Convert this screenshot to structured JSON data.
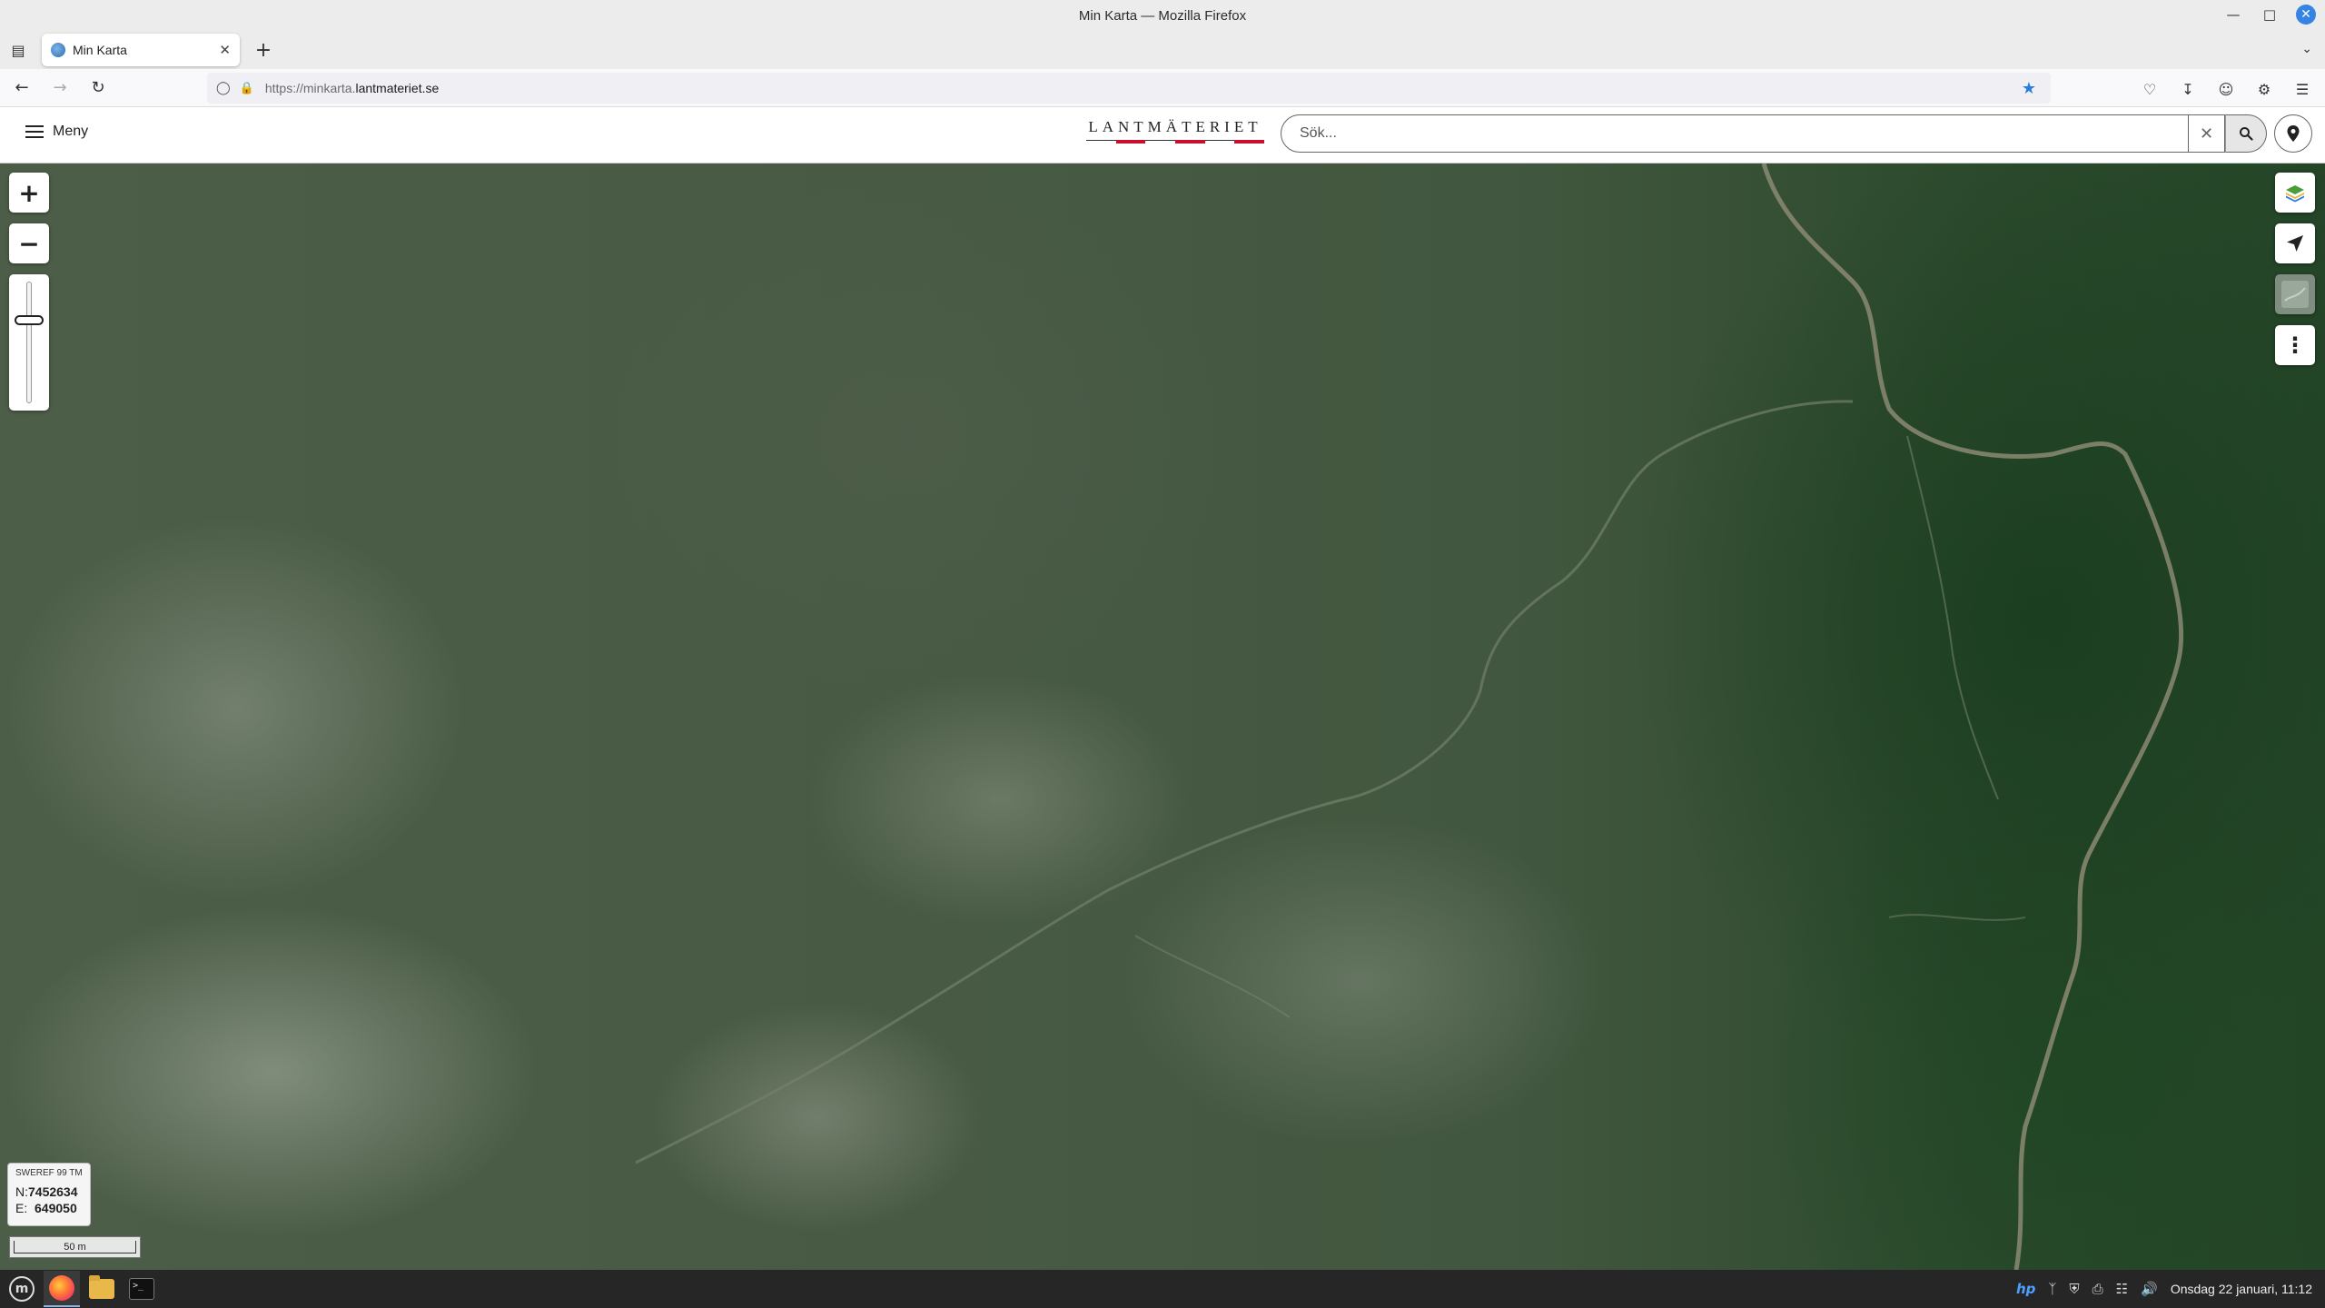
{
  "window": {
    "title": "Min Karta — Mozilla Firefox"
  },
  "browser": {
    "tab_title": "Min Karta",
    "url_prefix": "https://minkarta.",
    "url_domain": "lantmateriet.se"
  },
  "app": {
    "menu_label": "Meny",
    "logo_text": "LANTMÄTERIET",
    "search_placeholder": "Sök..."
  },
  "map": {
    "zoom_in_label": "+",
    "zoom_out_label": "−",
    "zoom_level_fraction": 0.3,
    "coords": {
      "crs": "SWEREF 99 TM",
      "n_label": "N:",
      "n_value": "7452634",
      "e_label": "E:",
      "e_value": "649050"
    },
    "scale_label": "50 m"
  },
  "taskbar": {
    "clock": "Onsdag 22 januari, 11:12"
  },
  "colors": {
    "accent": "#2a7cdf",
    "logo_red": "#c8102e"
  }
}
